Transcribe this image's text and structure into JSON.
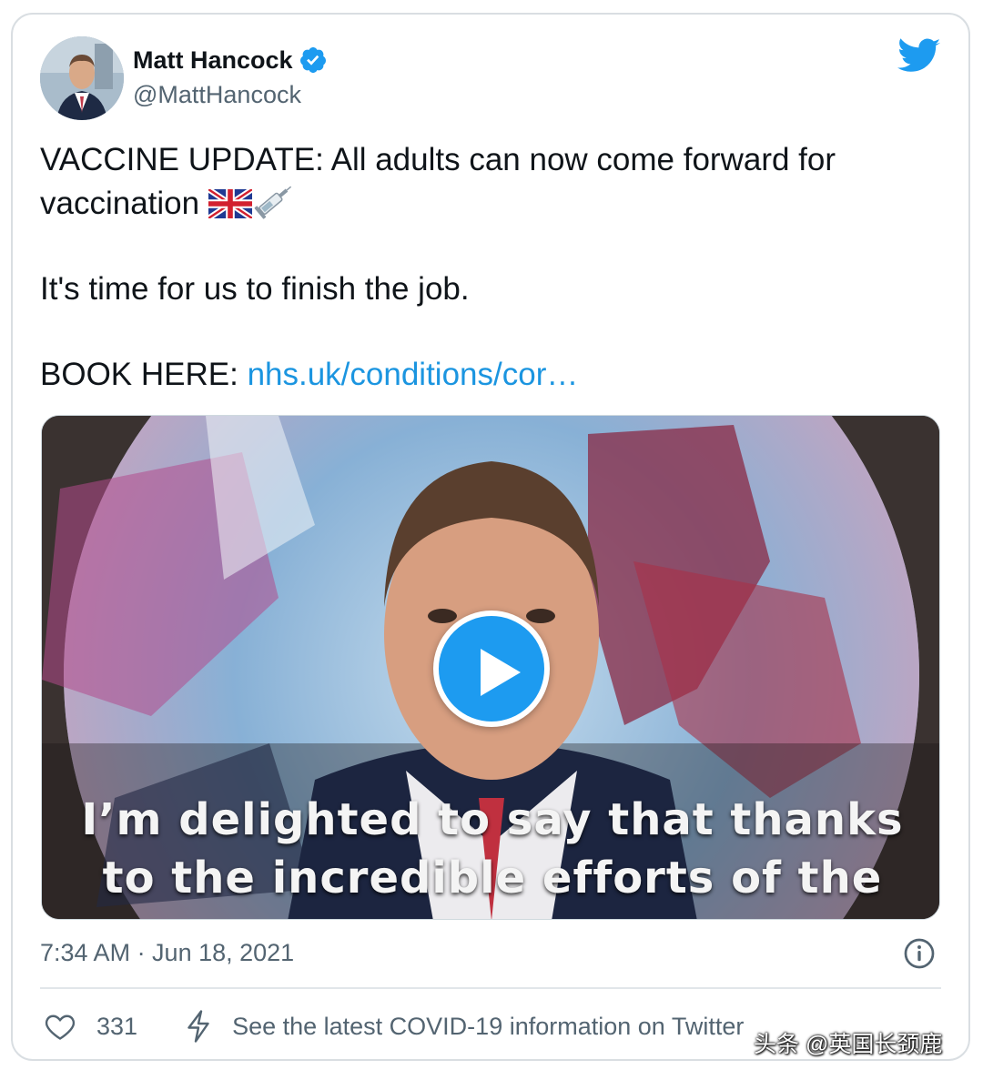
{
  "author": {
    "name": "Matt Hancock",
    "handle": "@MattHancock",
    "verified": true,
    "avatar_icon": "profile-photo"
  },
  "tweet": {
    "line1": "VACCINE UPDATE: All adults can now come forward for",
    "line2": "vaccination",
    "line2_emoji": [
      "uk-flag-icon",
      "syringe-icon"
    ],
    "line3": "It's time for us to finish the job.",
    "book_prefix": "BOOK HERE: ",
    "link_text": "nhs.uk/conditions/cor…"
  },
  "media": {
    "type": "video",
    "caption_line1": "I’m delighted to say that thanks",
    "caption_line2": "to the incredible efforts of the",
    "play_icon": "play-icon"
  },
  "meta": {
    "timestamp": "7:34 AM · Jun 18, 2021"
  },
  "actions": {
    "likes": "331",
    "covid_notice": "See the latest COVID-19 information on Twitter"
  },
  "watermark": "头条 @英国长颈鹿",
  "colors": {
    "twitter_blue": "#1d9bf0",
    "link": "#1b95e0",
    "text": "#0f1419",
    "secondary": "#536471"
  }
}
